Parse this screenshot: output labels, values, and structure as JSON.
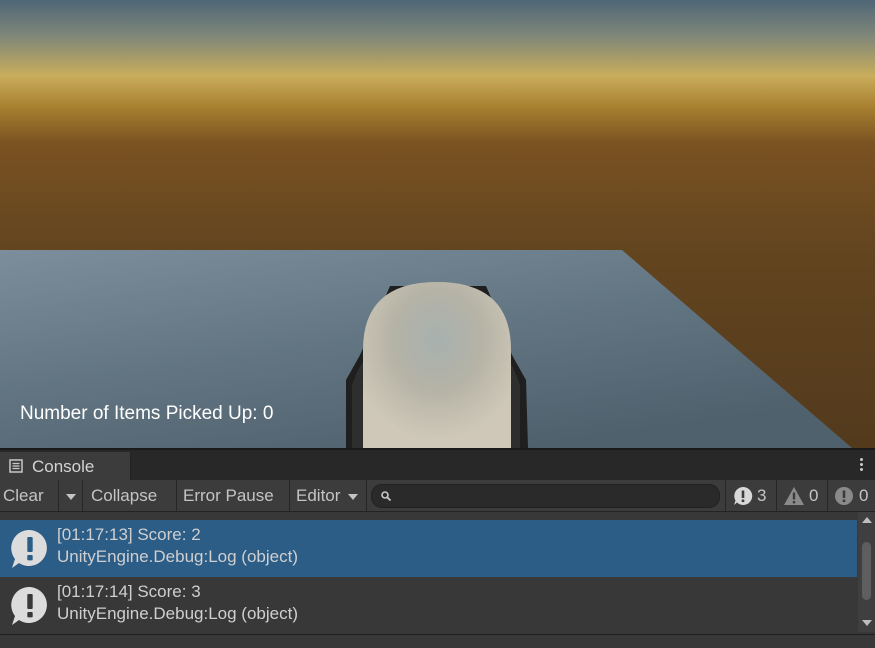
{
  "game": {
    "hud_text": "Number of Items Picked Up: 0"
  },
  "console": {
    "tab_label": "Console",
    "toolbar": {
      "clear_label": "Clear",
      "collapse_label": "Collapse",
      "error_pause_label": "Error Pause",
      "editor_label": "Editor",
      "search_value": ""
    },
    "counts": {
      "logs": "3",
      "warnings": "0",
      "errors": "0"
    },
    "entries": [
      {
        "line1": "[01:17:13] Score: 2",
        "line2": "UnityEngine.Debug:Log (object)",
        "selected": true
      },
      {
        "line1": "[01:17:14] Score: 3",
        "line2": "UnityEngine.Debug:Log (object)",
        "selected": false
      }
    ]
  },
  "colors": {
    "selection": "#2c5d87",
    "panel": "#383838",
    "ground": "#6b7f8c",
    "sky_horizon": "#c6a84e"
  }
}
